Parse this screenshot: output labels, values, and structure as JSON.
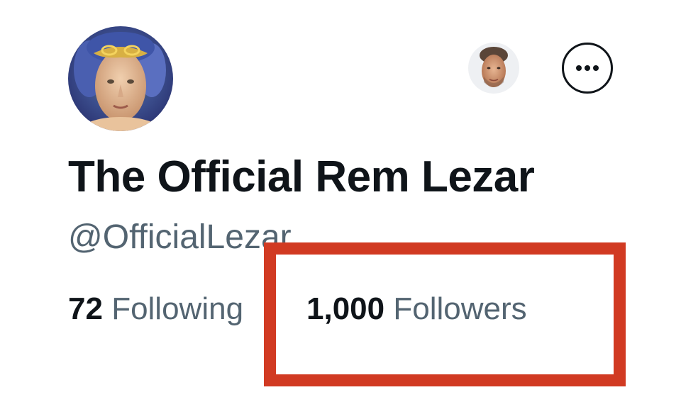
{
  "profile": {
    "display_name": "The Official Rem Lezar",
    "handle": "@OfficialLezar",
    "avatar_icon": "profile-avatar",
    "viewer_avatar_icon": "viewer-avatar",
    "more_icon": "more-horizontal-icon"
  },
  "stats": {
    "following_count": "72",
    "following_label": "Following",
    "followers_count": "1,000",
    "followers_label": "Followers"
  },
  "colors": {
    "text_primary": "#0f1419",
    "text_secondary": "#536471",
    "highlight": "#d13a22",
    "background": "#ffffff"
  }
}
